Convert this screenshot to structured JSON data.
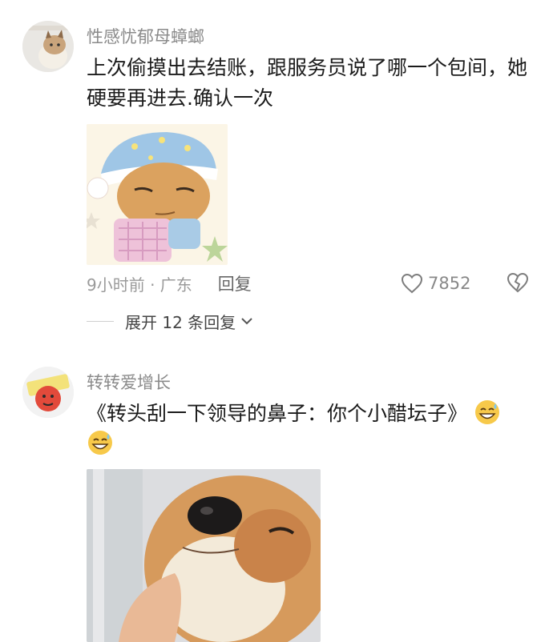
{
  "comments": [
    {
      "username": "性感忧郁母蟑螂",
      "text": "上次偷摸出去结账，跟服务员说了哪一个包间，她硬要再进去.确认一次",
      "time_location": "9小时前 · 广东",
      "reply_label": "回复",
      "likes": "7852",
      "expand_label": "展开 12 条回复",
      "image": "cartoon-sleepy-boy-sticker",
      "avatar": "cat-avatar"
    },
    {
      "username": "转转爱增长",
      "text": "《转头刮一下领导的鼻子：你个小醋坛子》",
      "image": "shiba-dog-smug-photo",
      "avatar": "red-character-avatar"
    }
  ],
  "icons": {
    "like": "heart-outline-icon",
    "dislike": "broken-heart-icon",
    "expand": "chevron-down-icon",
    "emoji": "grinning-sweat-emoji"
  },
  "colors": {
    "text": "#1b1b1b",
    "meta": "#9a9a9a",
    "username": "#8a8a8a"
  }
}
